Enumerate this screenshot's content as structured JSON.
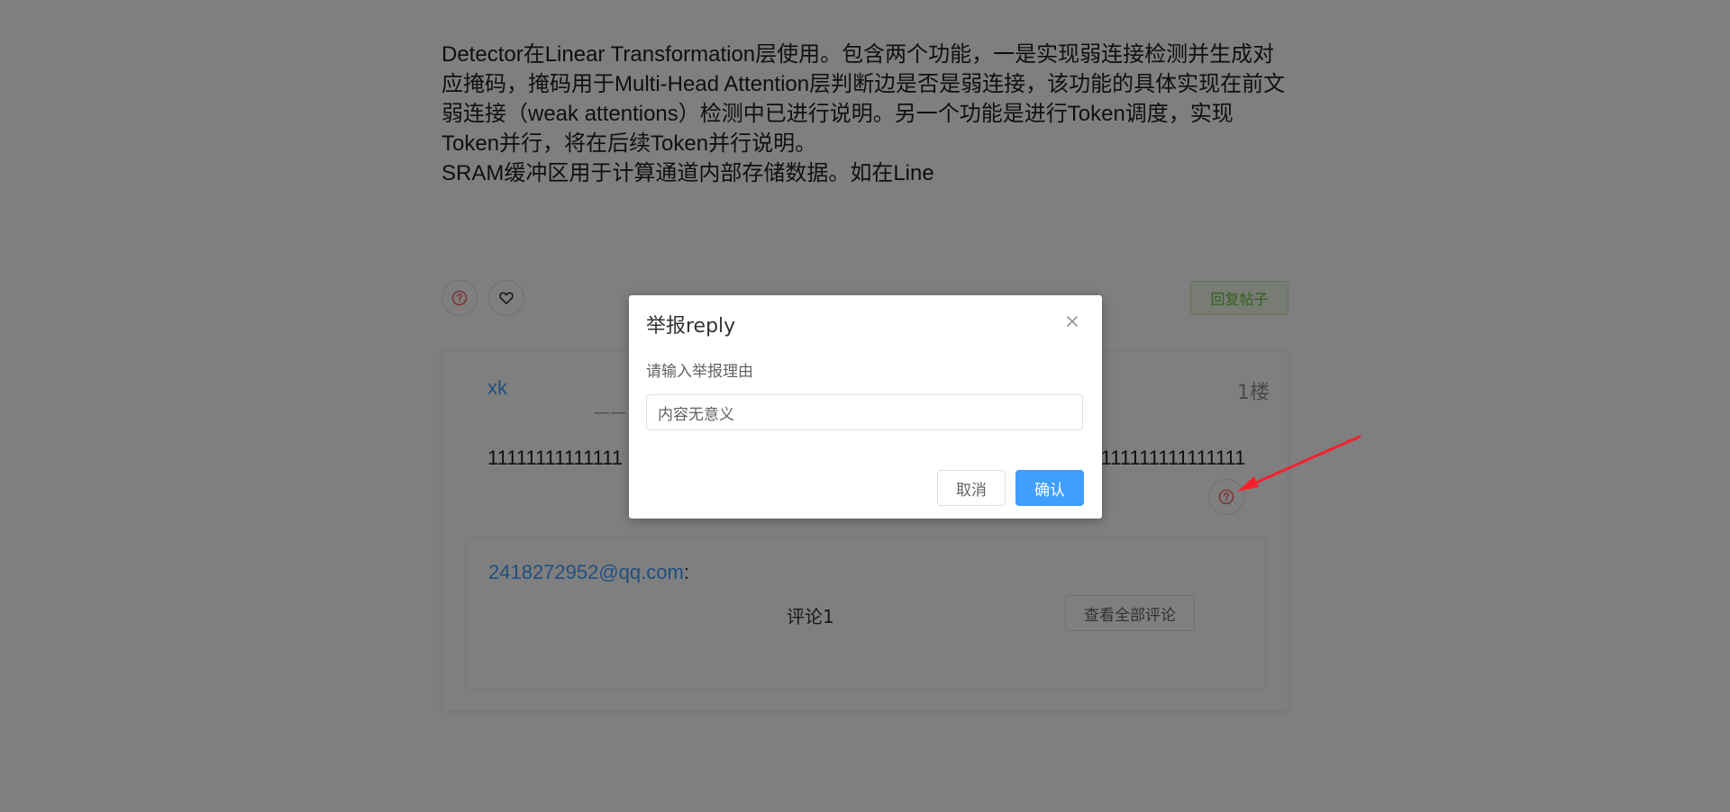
{
  "article": {
    "paragraphs": [
      "Detector在Linear Transformation层使用。包含两个功能，一是实现弱连接检测并生成对应掩码，掩码用于Multi-Head Attention层判断边是否是弱连接，该功能的具体实现在前文弱连接（weak attentions）检测中已进行说明。另一个功能是进行Token调度，实现Token并行，将在后续Token并行说明。",
      "SRAM缓冲区用于计算通道内部存储数据。如在Line"
    ]
  },
  "actions": {
    "report_icon": "question-circle-icon",
    "like_icon": "heart-icon",
    "reply_label": "回复帖子"
  },
  "floor": {
    "user": "xk",
    "floor_no": "1楼",
    "sub_prefix": "——",
    "body_left": "11111111111111",
    "body_right": "1111111111111111"
  },
  "comment": {
    "user": "2418272952@qq.com",
    "colon": ":",
    "text": "评论1",
    "view_all_label": "查看全部评论"
  },
  "dialog": {
    "title": "举报reply",
    "label": "请输入举报理由",
    "input_value": "内容无意义",
    "cancel_label": "取消",
    "confirm_label": "确认"
  },
  "colors": {
    "accent": "#409eff",
    "danger": "#f56c6c",
    "success": "#67c23a",
    "annotation_arrow": "#f5222d"
  }
}
